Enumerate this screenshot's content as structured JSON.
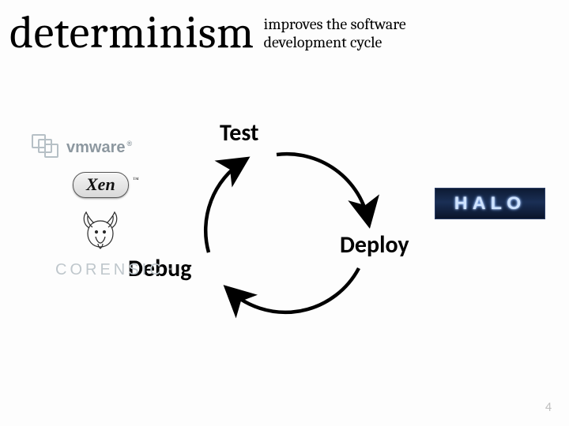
{
  "title": "determinism",
  "subtitle_line1": "improves the software",
  "subtitle_line2": "development cycle",
  "cycle": {
    "test": "Test",
    "deploy": "Deploy",
    "debug": "Debug"
  },
  "logos": {
    "vmware": "vmware",
    "vmware_reg": "®",
    "xen": "Xen",
    "xen_tm": "™",
    "gnu": "gnu-head",
    "corensic": "CORENSIC",
    "corensic_tm": "™",
    "halo": "HALO"
  },
  "page_number": "4"
}
